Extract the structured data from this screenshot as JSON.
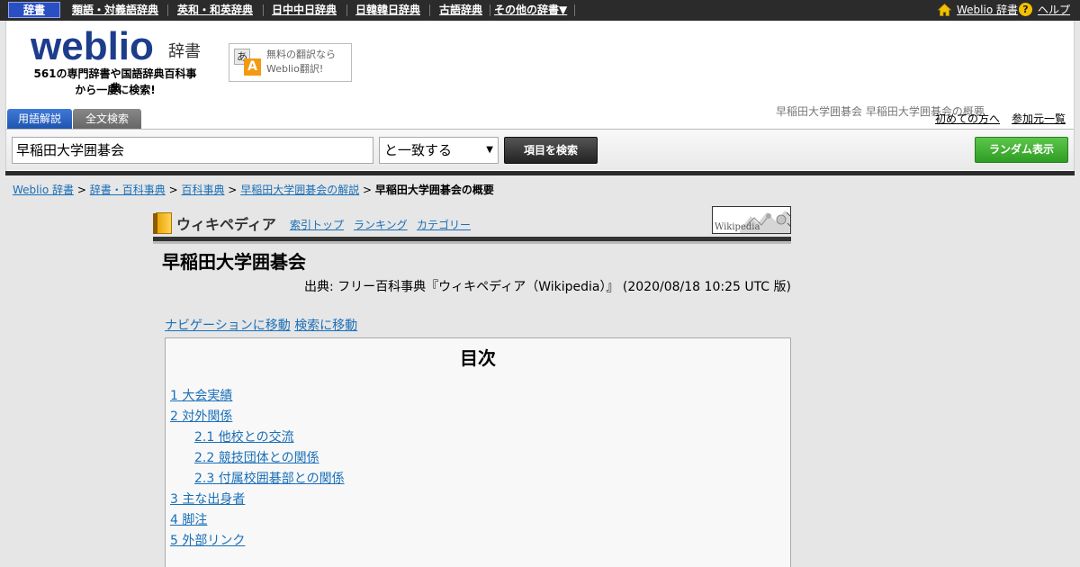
{
  "topnav": {
    "active_tab": "辞書",
    "links": [
      "類語・対義語辞典",
      "英和・和英辞典",
      "日中中日辞典",
      "日韓韓日辞典",
      "古語辞典",
      "その他の辞書▼"
    ],
    "weblio_link": "Weblio 辞書",
    "help_icon": "?",
    "help_link": "ヘルプ"
  },
  "header": {
    "logo": "weblio",
    "logo_sub": "辞書",
    "tagline_line1": "561の専門辞書や国語辞典百科事典",
    "tagline_line2": "から一度に検索!",
    "translate_icon_a": "あ",
    "translate_icon_b": "A",
    "translate_line1": "無料の翻訳なら",
    "translate_line2": "Weblio翻訳!",
    "page_crumb": "早稲田大学囲碁会 早稲田大学囲碁会の概要",
    "first_time_link": "初めての方へ",
    "sources_link": "参加元一覧"
  },
  "search": {
    "tab_terms": "用語解説",
    "tab_fulltext": "全文検索",
    "query": "早稲田大学囲碁会",
    "match_mode": "と一致する",
    "match_arrow": "▼",
    "search_button": "項目を検索",
    "random_button": "ランダム表示"
  },
  "breadcrumb": {
    "items": [
      "Weblio 辞書",
      "辞書・百科事典",
      "百科事典",
      "早稲田大学囲碁会の解説"
    ],
    "separator": ">",
    "current": "早稲田大学囲碁会の概要"
  },
  "wiki": {
    "title": "ウィキペディア",
    "nav": [
      "索引トップ",
      "ランキング",
      "カテゴリー"
    ],
    "logo_text": "Wikipedia"
  },
  "article": {
    "title": "早稲田大学囲碁会",
    "source": "出典: フリー百科事典『ウィキペディア（Wikipedia）』 (2020/08/18 10:25 UTC 版)",
    "nav_link": "ナビゲーションに移動",
    "search_link": "検索に移動"
  },
  "toc": {
    "title": "目次",
    "items": [
      {
        "label": "1 大会実績",
        "level": 1
      },
      {
        "label": "2 対外関係",
        "level": 1
      },
      {
        "label": "2.1 他校との交流",
        "level": 2
      },
      {
        "label": "2.2 競技団体との関係",
        "level": 2
      },
      {
        "label": "2.3 付属校囲碁部との関係",
        "level": 2
      },
      {
        "label": "3 主な出身者",
        "level": 1
      },
      {
        "label": "4 脚注",
        "level": 1
      },
      {
        "label": "5 外部リンク",
        "level": 1
      }
    ]
  },
  "colors": {
    "link": "#1a6fb8",
    "topbar": "#2b2b2b",
    "random_button": "#3aa52d",
    "active_tab": "#2a4fc2"
  }
}
